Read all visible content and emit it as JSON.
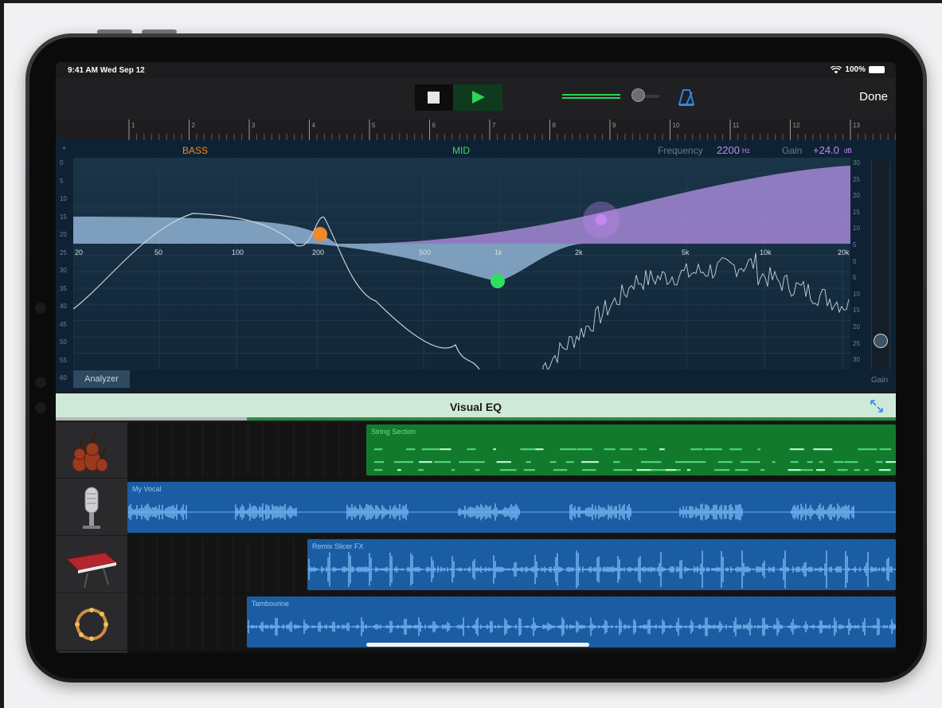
{
  "status_bar": {
    "time": "9:41 AM  Wed Sep 12",
    "battery": "100%"
  },
  "toolbar": {
    "done_label": "Done",
    "volume_level": 0.6
  },
  "ruler": {
    "bars": [
      "1",
      "2",
      "3",
      "4",
      "5",
      "6",
      "7",
      "8",
      "9",
      "10",
      "11",
      "12",
      "13"
    ]
  },
  "eq": {
    "band_bass": "BASS",
    "band_mid": "MID",
    "frequency_label": "Frequency",
    "frequency_value": "2200",
    "frequency_unit": "Hz",
    "gain_label": "Gain",
    "gain_value": "+24.0",
    "gain_unit": "dB",
    "left_top_marker": "+",
    "freq_ticks": [
      "20",
      "50",
      "100",
      "200",
      "500",
      "1k",
      "2k",
      "5k",
      "10k",
      "20k"
    ],
    "db_left": [
      "0",
      "5",
      "10",
      "15",
      "20",
      "25",
      "30",
      "35",
      "40",
      "45",
      "50",
      "55",
      "60"
    ],
    "db_right": [
      "30",
      "25",
      "20",
      "15",
      "10",
      "5",
      "0",
      "5",
      "10",
      "15",
      "20",
      "25",
      "30"
    ],
    "analyzer_label": "Analyzer",
    "gain_slider_label": "Gain",
    "colors": {
      "bass": "#f0892b",
      "mid": "#2fe060",
      "high": "#c488ee"
    }
  },
  "visual_eq": {
    "title": "Visual EQ"
  },
  "tracks": [
    {
      "instrument_icon": "violin-cello-icon",
      "region_name": "String Section",
      "kind": "midi"
    },
    {
      "instrument_icon": "microphone-icon",
      "region_name": "My Vocal",
      "kind": "audio"
    },
    {
      "instrument_icon": "keyboard-synth-icon",
      "region_name": "Remix Slicer FX",
      "kind": "audio"
    },
    {
      "instrument_icon": "tambourine-icon",
      "region_name": "Tambourine",
      "kind": "audio"
    }
  ]
}
